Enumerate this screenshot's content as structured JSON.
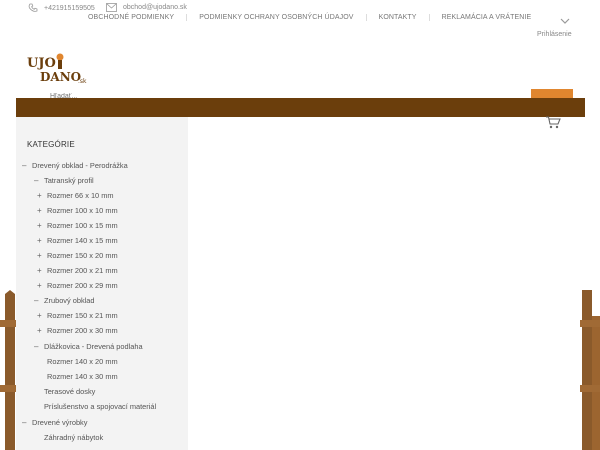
{
  "header": {
    "phone": "+421915159505",
    "email": "obchod@ujodano.sk",
    "login_label": "Prihlásenie",
    "nav": [
      {
        "label": "OBCHODNÉ PODMIENKY"
      },
      {
        "label": "PODMIENKY OCHRANY OSOBNÝCH ÚDAJOV"
      },
      {
        "label": "KONTAKTY"
      },
      {
        "label": "REKLAMÁCIA A VRÁTENIE"
      }
    ]
  },
  "logo": {
    "text_line1": "UJO",
    "text_line2": "DANO",
    "text_suffix": ".sk"
  },
  "search": {
    "placeholder": "Hľadať...",
    "value": ""
  },
  "colors": {
    "brand_brown": "#6b3e0c",
    "accent_orange": "#e0862f",
    "sidebar_bg": "#f3f3f3"
  },
  "sidebar": {
    "title": "KATEGÓRIE",
    "items": [
      {
        "label": "Drevený obklad - Perodrážka",
        "marker": "–"
      },
      {
        "label": "Tatranský profil",
        "marker": "–"
      },
      {
        "label": "Rozmer 66 x 10 mm",
        "marker": "+"
      },
      {
        "label": "Rozmer 100 x 10 mm",
        "marker": "+"
      },
      {
        "label": "Rozmer 100 x 15 mm",
        "marker": "+"
      },
      {
        "label": "Rozmer 140 x 15 mm",
        "marker": "+"
      },
      {
        "label": "Rozmer 150 x 20 mm",
        "marker": "+"
      },
      {
        "label": "Rozmer 200 x 21 mm",
        "marker": "+"
      },
      {
        "label": "Rozmer 200 x 29 mm",
        "marker": "+"
      },
      {
        "label": "Zrubový obklad",
        "marker": "–"
      },
      {
        "label": "Rozmer 150 x 21 mm",
        "marker": "+"
      },
      {
        "label": "Rozmer 200 x 30 mm",
        "marker": "+"
      },
      {
        "label": "Dlážkovica - Drevená podlaha",
        "marker": "–"
      },
      {
        "label": "Rozmer 140 x 20 mm",
        "marker": ""
      },
      {
        "label": "Rozmer 140 x 30 mm",
        "marker": ""
      },
      {
        "label": "Terasové dosky",
        "marker": ""
      },
      {
        "label": "Príslušenstvo a spojovací materiál",
        "marker": ""
      },
      {
        "label": "Drevené výrobky",
        "marker": "–"
      },
      {
        "label": "Záhradný nábytok",
        "marker": ""
      }
    ]
  }
}
